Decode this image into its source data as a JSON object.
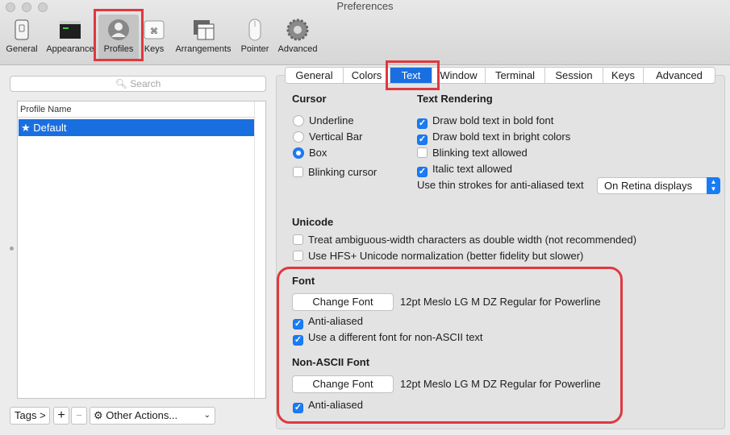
{
  "window": {
    "title": "Preferences"
  },
  "toolbar": {
    "items": [
      {
        "label": "General",
        "icon": "general-icon"
      },
      {
        "label": "Appearance",
        "icon": "appearance-icon"
      },
      {
        "label": "Profiles",
        "icon": "profiles-icon",
        "selected": true
      },
      {
        "label": "Keys",
        "icon": "keys-icon"
      },
      {
        "label": "Arrangements",
        "icon": "arrangements-icon"
      },
      {
        "label": "Pointer",
        "icon": "pointer-icon"
      },
      {
        "label": "Advanced",
        "icon": "advanced-gear-icon"
      }
    ]
  },
  "sidebar": {
    "search_placeholder": "Search",
    "list_header": "Profile Name",
    "profiles": [
      {
        "label": "★ Default",
        "selected": true
      }
    ],
    "tags_button": "Tags >",
    "add_button": "+",
    "remove_button": "−",
    "other_actions": "Other Actions..."
  },
  "tabs": [
    "General",
    "Colors",
    "Text",
    "Window",
    "Terminal",
    "Session",
    "Keys",
    "Advanced"
  ],
  "active_tab": "Text",
  "cursor": {
    "title": "Cursor",
    "options": [
      "Underline",
      "Vertical Bar",
      "Box"
    ],
    "selected": "Box",
    "blinking_label": "Blinking cursor",
    "blinking": false
  },
  "text_rendering": {
    "title": "Text Rendering",
    "options": [
      {
        "label": "Draw bold text in bold font",
        "checked": true
      },
      {
        "label": "Draw bold text in bright colors",
        "checked": true
      },
      {
        "label": "Blinking text allowed",
        "checked": false
      },
      {
        "label": "Italic text allowed",
        "checked": true
      }
    ],
    "thin_strokes_label": "Use thin strokes for anti-aliased text",
    "thin_strokes_value": "On Retina displays"
  },
  "unicode": {
    "title": "Unicode",
    "options": [
      {
        "label": "Treat ambiguous-width characters as double width (not recommended)",
        "checked": false
      },
      {
        "label": "Use HFS+ Unicode normalization (better fidelity but slower)",
        "checked": false
      }
    ]
  },
  "font": {
    "title": "Font",
    "change_button": "Change Font",
    "font_name": "12pt Meslo LG M DZ Regular for Powerline",
    "anti_aliased_label": "Anti-aliased",
    "anti_aliased": true,
    "different_nonascii_label": "Use a different font for non-ASCII text",
    "different_nonascii": true
  },
  "non_ascii_font": {
    "title": "Non-ASCII Font",
    "change_button": "Change Font",
    "font_name": "12pt Meslo LG M DZ Regular for Powerline",
    "anti_aliased_label": "Anti-aliased",
    "anti_aliased": true
  },
  "colors": {
    "accent": "#1a6fe0",
    "highlight": "#e0383f"
  }
}
